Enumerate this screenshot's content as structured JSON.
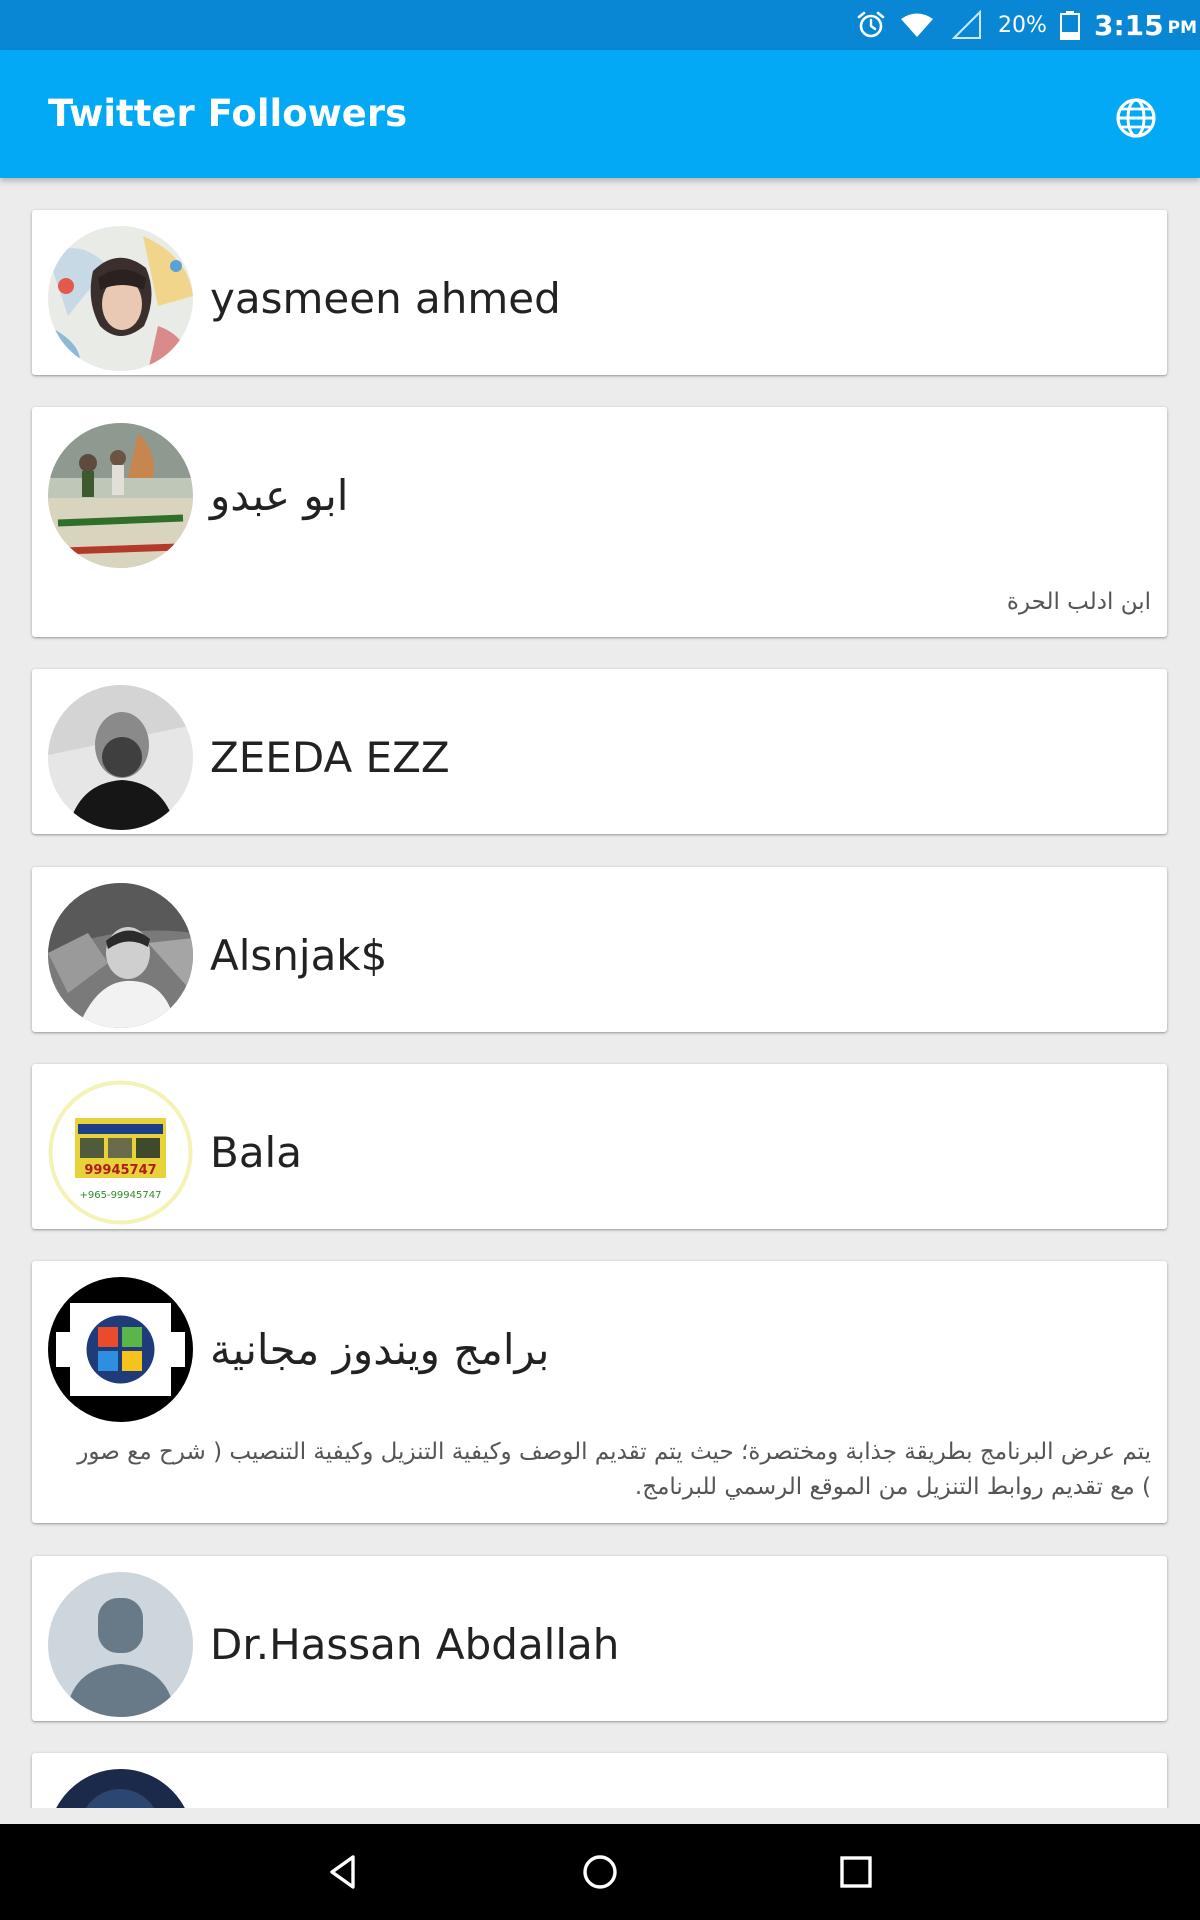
{
  "status_bar": {
    "battery_percent": "20%",
    "time": "3:15",
    "ampm": "PM",
    "icons": [
      "alarm-icon",
      "wifi-icon",
      "signal-icon",
      "battery-icon"
    ]
  },
  "app_bar": {
    "title": "Twitter Followers",
    "language_icon": "globe-icon"
  },
  "followers": [
    {
      "name": "yasmeen ahmed",
      "bio": ""
    },
    {
      "name": "ابو عبدو",
      "bio": "ابن ادلب الحرة"
    },
    {
      "name": "ZEEDA EZZ",
      "bio": ""
    },
    {
      "name": "Alsnjak$",
      "bio": ""
    },
    {
      "name": "Bala",
      "bio": "",
      "avatar_text": [
        "+965-99945747",
        "99945747"
      ]
    },
    {
      "name": "برامج ويندوز مجانية",
      "bio": "يتم عرض البرنامج بطريقة جذابة ومختصرة؛ حيث يتم تقديم الوصف وكيفية التنزيل وكيفية التنصيب ( شرح مع صور ) مع تقديم روابط التنزيل من الموقع الرسمي للبرنامج."
    },
    {
      "name": "Dr.Hassan Abdallah",
      "bio": ""
    },
    {
      "name": "",
      "bio": ""
    }
  ],
  "nav_bar": {
    "icons": [
      "back-icon",
      "home-icon",
      "recents-icon"
    ]
  },
  "colors": {
    "status_bar": "#0a87d4",
    "app_bar": "#03a9f4",
    "background": "#ececec",
    "card": "#ffffff"
  }
}
